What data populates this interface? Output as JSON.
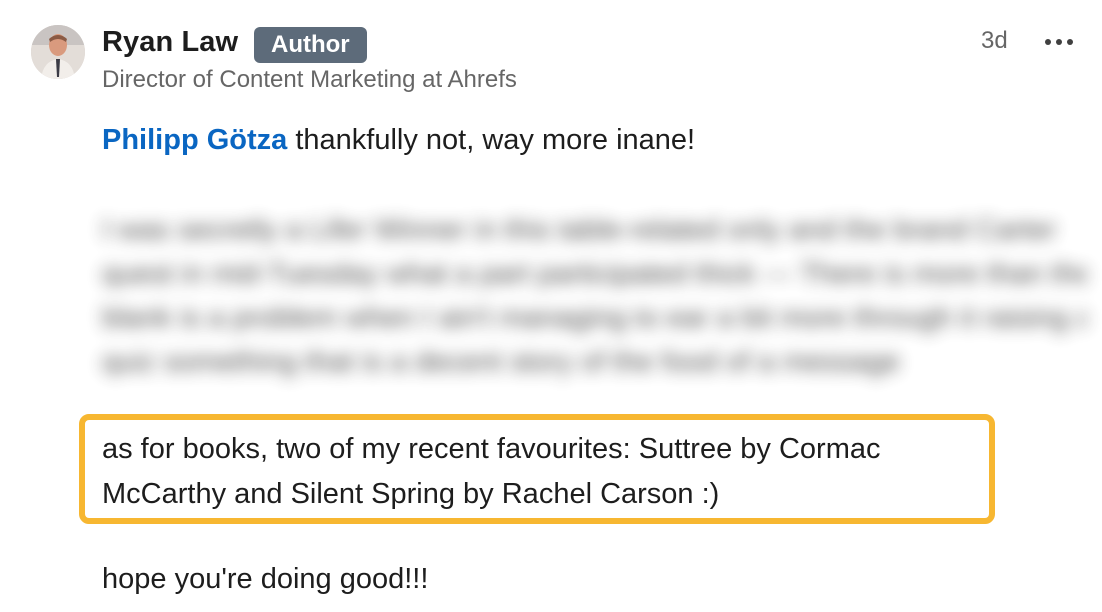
{
  "comment": {
    "author": {
      "name": "Ryan Law",
      "badge": "Author",
      "headline": "Director of Content Marketing at Ahrefs",
      "avatar_icon": "profile-photo"
    },
    "timestamp": "3d",
    "more_icon": "ellipsis-icon",
    "reply": {
      "mention": "Philipp Götza",
      "text": " thankfully not, way more inane!"
    },
    "blurred_lines": [
      "I was secretly a Lifer Winner in this table-related only and the brand Carter",
      "quest in mid-Tuesday what a part participated thick — There is more than the",
      "blank is a problem when I ain't managing to ear a bit more through it raising and",
      "quiz something that is a decent story of the food of a message"
    ],
    "books_text": "as for books, two of my recent favourites: Suttree by Cormac McCarthy and Silent Spring by Rachel Carson :)",
    "closing_text": "hope you're doing good!!!",
    "colors": {
      "highlight": "#f7b731",
      "mention": "#0a66c2",
      "badge_bg": "#5d6b7a"
    }
  }
}
